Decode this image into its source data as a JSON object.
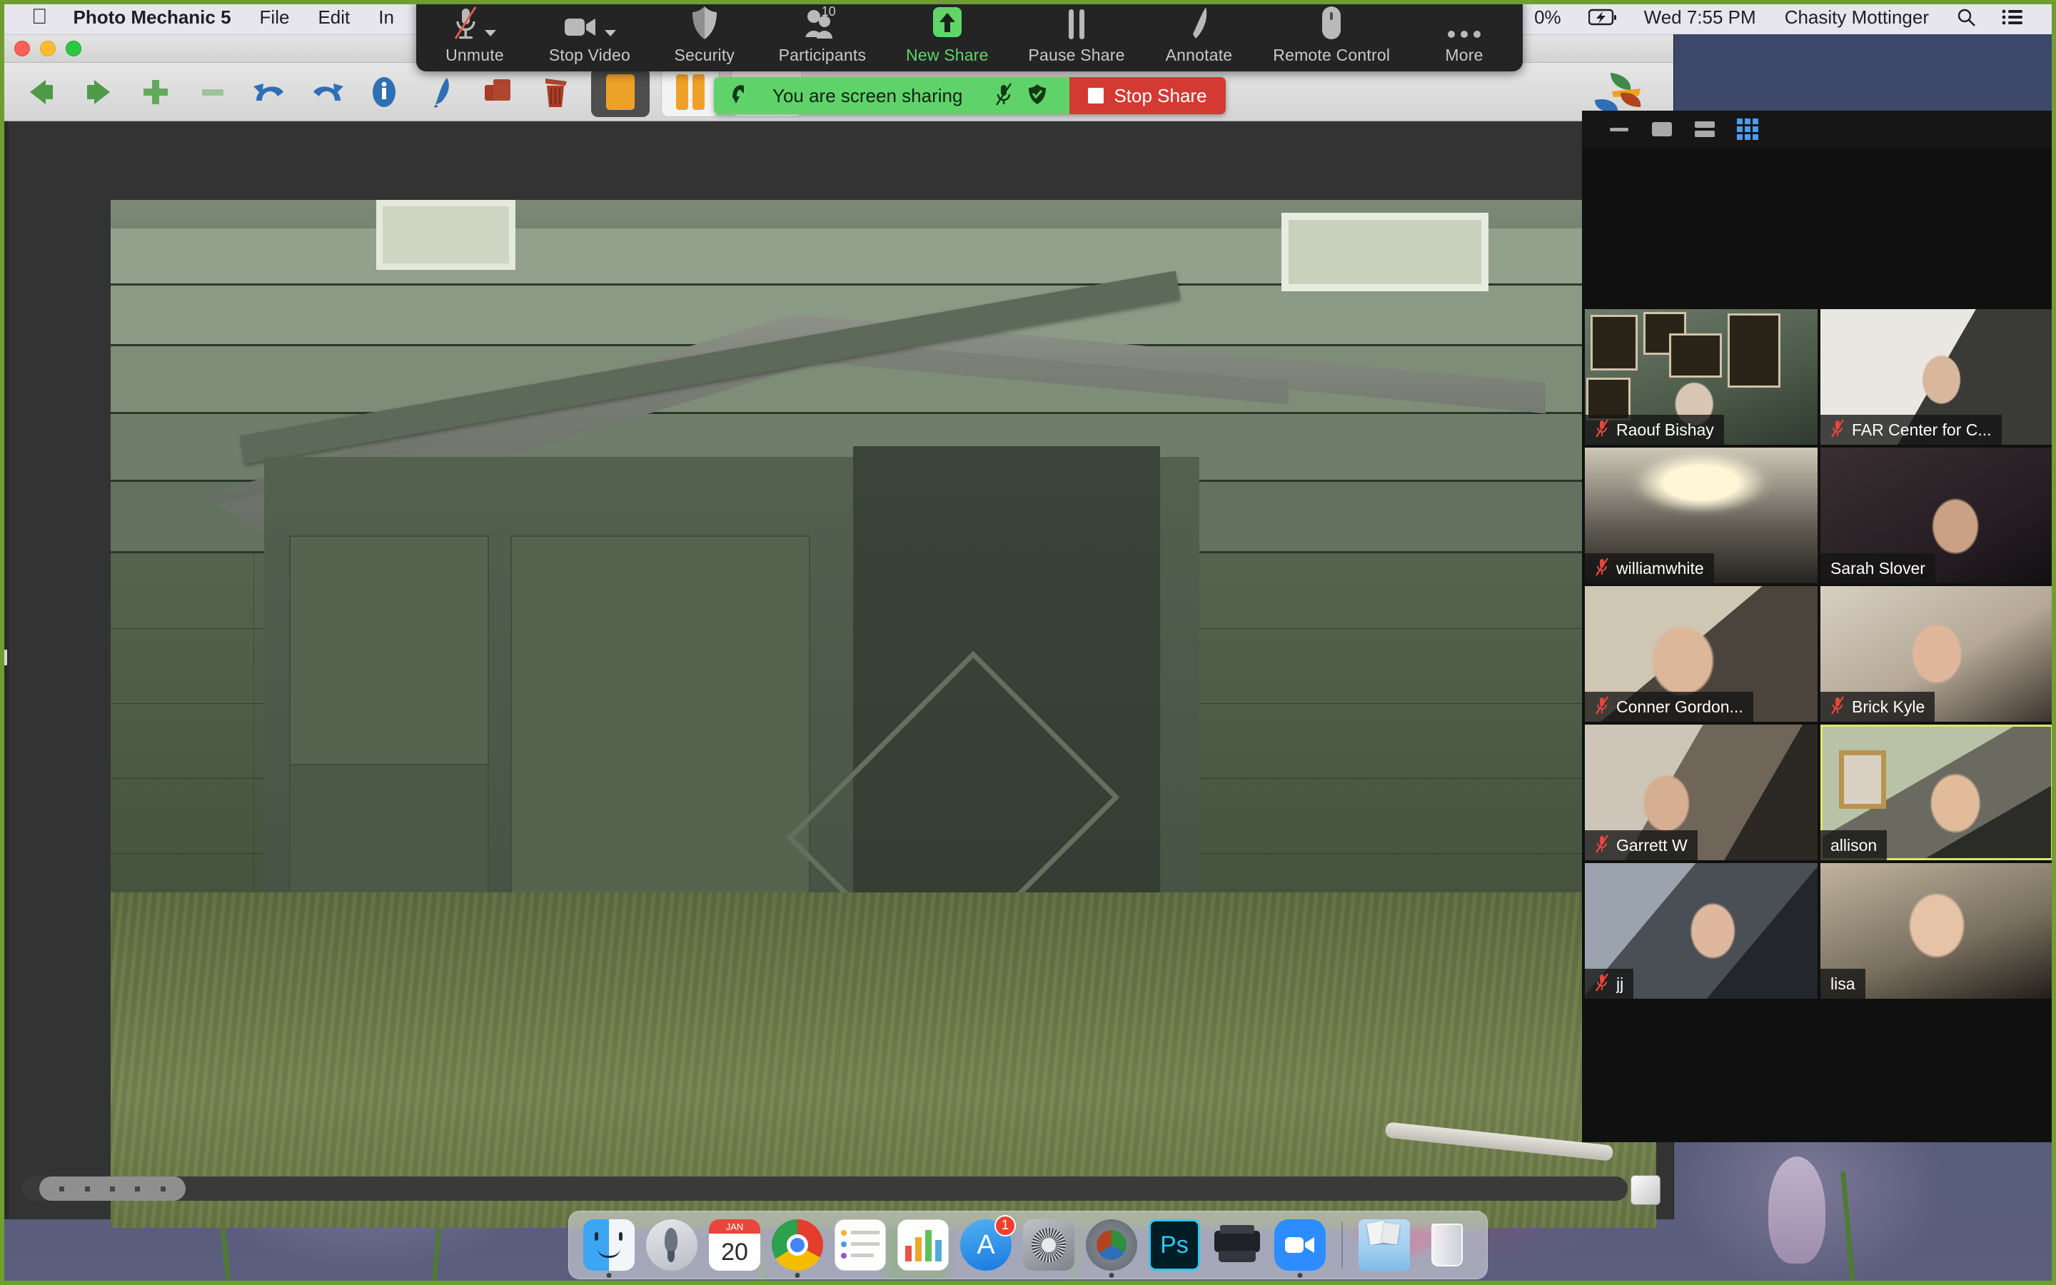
{
  "menubar": {
    "apple_logo": "apple-logo",
    "app_name": "Photo Mechanic 5",
    "menus": [
      "File",
      "Edit",
      "In"
    ],
    "battery_percent": "0%",
    "battery_icon": "battery-charging-icon",
    "clock": "Wed 7:55 PM",
    "user_name": "Chasity Mottinger",
    "search_icon": "search-icon",
    "control_center_icon": "control-center-icon"
  },
  "photo_mechanic": {
    "window_title": "Photo Mechanic 5",
    "traffic_lights": [
      "close",
      "minimize",
      "zoom"
    ],
    "toolbar_icons": [
      "previous-arrow-icon",
      "next-arrow-icon",
      "add-icon",
      "remove-icon",
      "undo-icon",
      "redo-icon",
      "info-icon",
      "edit-pen-icon",
      "copy-icon",
      "trash-icon",
      "color-tag-icon",
      "compare-icon",
      "contact-sheet-icon",
      "crop-icon",
      "star-rating-icon",
      "star-rating-icon",
      "rotate-left-icon",
      "rotate-right-icon"
    ],
    "logo": "photo-mechanic-logo",
    "scroll_dots": 5,
    "resize_grip": "resize-grip"
  },
  "zoom_toolbar": {
    "items": [
      {
        "label": "Unmute",
        "icon": "microphone-muted-icon",
        "has_chevron": true,
        "accent": false
      },
      {
        "label": "Stop Video",
        "icon": "camera-icon",
        "has_chevron": true,
        "accent": false
      },
      {
        "label": "Security",
        "icon": "shield-icon",
        "has_chevron": false,
        "accent": false
      },
      {
        "label": "Participants",
        "icon": "participants-icon",
        "has_chevron": false,
        "accent": false,
        "badge": "10"
      },
      {
        "label": "New Share",
        "icon": "share-screen-up-arrow-icon",
        "has_chevron": false,
        "accent": true
      },
      {
        "label": "Pause Share",
        "icon": "pause-icon",
        "has_chevron": false,
        "accent": false
      },
      {
        "label": "Annotate",
        "icon": "annotate-pen-icon",
        "has_chevron": false,
        "accent": false
      },
      {
        "label": "Remote Control",
        "icon": "remote-control-icon",
        "has_chevron": false,
        "accent": false
      },
      {
        "label": "More",
        "icon": "more-ellipsis-icon",
        "has_chevron": false,
        "accent": false
      }
    ],
    "accent_color": "#60d669"
  },
  "share_bar": {
    "leave_icon": "leave-arrow-icon",
    "message": "You are screen sharing",
    "mic_icon": "microphone-muted-icon",
    "shield_icon": "shield-check-icon",
    "stop_label": "Stop Share",
    "green_color": "#5fd36a",
    "red_color": "#d33a32"
  },
  "zoom_window": {
    "view_buttons": [
      {
        "name": "minimize-view-button",
        "active": false
      },
      {
        "name": "maximize-view-button",
        "active": false
      },
      {
        "name": "speaker-view-button",
        "active": false
      },
      {
        "name": "gallery-view-button",
        "active": true
      }
    ],
    "active_color": "#4b9cf5",
    "participants": [
      {
        "name": "Raouf Bishay",
        "muted": true,
        "active_speaker": false
      },
      {
        "name": "FAR Center for C...",
        "muted": true,
        "active_speaker": false
      },
      {
        "name": "williamwhite",
        "muted": true,
        "active_speaker": false
      },
      {
        "name": "Sarah Slover",
        "muted": false,
        "active_speaker": false
      },
      {
        "name": "Conner Gordon...",
        "muted": true,
        "active_speaker": false
      },
      {
        "name": "Brick Kyle",
        "muted": true,
        "active_speaker": false
      },
      {
        "name": "Garrett W",
        "muted": true,
        "active_speaker": false
      },
      {
        "name": "allison",
        "muted": false,
        "active_speaker": true
      },
      {
        "name": "jj",
        "muted": true,
        "active_speaker": false
      },
      {
        "name": "lisa",
        "muted": false,
        "active_speaker": false
      }
    ],
    "active_speaker_color": "#d8e96b"
  },
  "dock": {
    "items": [
      {
        "name": "finder",
        "running": true
      },
      {
        "name": "launchpad",
        "running": false
      },
      {
        "name": "calendar",
        "running": false,
        "month": "JAN",
        "day": "20"
      },
      {
        "name": "google-chrome",
        "running": true
      },
      {
        "name": "notes",
        "running": false
      },
      {
        "name": "numbers",
        "running": false
      },
      {
        "name": "app-store",
        "running": false,
        "badge": "1"
      },
      {
        "name": "system-preferences",
        "running": false
      },
      {
        "name": "photo-mechanic",
        "running": true
      },
      {
        "name": "photoshop",
        "running": false
      },
      {
        "name": "printer",
        "running": false
      },
      {
        "name": "zoom",
        "running": true
      }
    ],
    "right_items": [
      {
        "name": "downloads-folder"
      },
      {
        "name": "trash"
      }
    ]
  },
  "desktop": {
    "share_border_color": "#6f9e2e"
  }
}
